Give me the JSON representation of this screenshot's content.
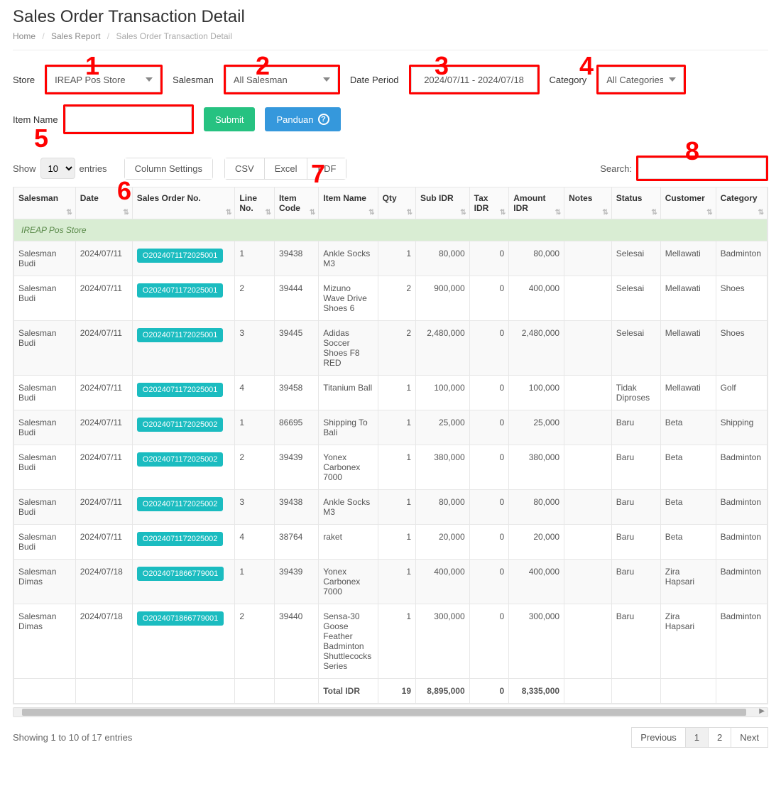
{
  "page_title": "Sales Order Transaction Detail",
  "breadcrumb": {
    "home": "Home",
    "sales_report": "Sales Report",
    "active": "Sales Order Transaction Detail"
  },
  "filters": {
    "store_label": "Store",
    "store_value": "IREAP Pos Store",
    "salesman_label": "Salesman",
    "salesman_value": "All Salesman",
    "date_label": "Date Period",
    "date_value": "2024/07/11 - 2024/07/18",
    "category_label": "Category",
    "category_value": "All Categories",
    "item_name_label": "Item Name",
    "item_name_value": "",
    "submit": "Submit",
    "panduan": "Panduan"
  },
  "table_controls": {
    "show": "Show",
    "entries": "entries",
    "page_size": "10",
    "column_settings": "Column Settings",
    "csv": "CSV",
    "excel": "Excel",
    "pdf": "PDF",
    "search_label": "Search:"
  },
  "columns": [
    "Salesman",
    "Date",
    "Sales Order No.",
    "Line No.",
    "Item Code",
    "Item Name",
    "Qty",
    "Sub IDR",
    "Tax IDR",
    "Amount IDR",
    "Notes",
    "Status",
    "Customer",
    "Category"
  ],
  "group_row": "IREAP Pos Store",
  "rows": [
    {
      "salesman": "Salesman Budi",
      "date": "2024/07/11",
      "order": "O2024071172025001",
      "line": "1",
      "code": "39438",
      "item": "Ankle Socks M3",
      "qty": "1",
      "sub": "80,000",
      "tax": "0",
      "amount": "80,000",
      "notes": "",
      "status": "Selesai",
      "customer": "Mellawati",
      "category": "Badminton"
    },
    {
      "salesman": "Salesman Budi",
      "date": "2024/07/11",
      "order": "O2024071172025001",
      "line": "2",
      "code": "39444",
      "item": "Mizuno Wave Drive Shoes 6",
      "qty": "2",
      "sub": "900,000",
      "tax": "0",
      "amount": "400,000",
      "notes": "",
      "status": "Selesai",
      "customer": "Mellawati",
      "category": "Shoes"
    },
    {
      "salesman": "Salesman Budi",
      "date": "2024/07/11",
      "order": "O2024071172025001",
      "line": "3",
      "code": "39445",
      "item": "Adidas Soccer Shoes F8 RED",
      "qty": "2",
      "sub": "2,480,000",
      "tax": "0",
      "amount": "2,480,000",
      "notes": "",
      "status": "Selesai",
      "customer": "Mellawati",
      "category": "Shoes"
    },
    {
      "salesman": "Salesman Budi",
      "date": "2024/07/11",
      "order": "O2024071172025001",
      "line": "4",
      "code": "39458",
      "item": "Titanium Ball",
      "qty": "1",
      "sub": "100,000",
      "tax": "0",
      "amount": "100,000",
      "notes": "",
      "status": "Tidak Diproses",
      "customer": "Mellawati",
      "category": "Golf"
    },
    {
      "salesman": "Salesman Budi",
      "date": "2024/07/11",
      "order": "O2024071172025002",
      "line": "1",
      "code": "86695",
      "item": "Shipping To Bali",
      "qty": "1",
      "sub": "25,000",
      "tax": "0",
      "amount": "25,000",
      "notes": "",
      "status": "Baru",
      "customer": "Beta",
      "category": "Shipping"
    },
    {
      "salesman": "Salesman Budi",
      "date": "2024/07/11",
      "order": "O2024071172025002",
      "line": "2",
      "code": "39439",
      "item": "Yonex Carbonex 7000",
      "qty": "1",
      "sub": "380,000",
      "tax": "0",
      "amount": "380,000",
      "notes": "",
      "status": "Baru",
      "customer": "Beta",
      "category": "Badminton"
    },
    {
      "salesman": "Salesman Budi",
      "date": "2024/07/11",
      "order": "O2024071172025002",
      "line": "3",
      "code": "39438",
      "item": "Ankle Socks M3",
      "qty": "1",
      "sub": "80,000",
      "tax": "0",
      "amount": "80,000",
      "notes": "",
      "status": "Baru",
      "customer": "Beta",
      "category": "Badminton"
    },
    {
      "salesman": "Salesman Budi",
      "date": "2024/07/11",
      "order": "O2024071172025002",
      "line": "4",
      "code": "38764",
      "item": "raket",
      "qty": "1",
      "sub": "20,000",
      "tax": "0",
      "amount": "20,000",
      "notes": "",
      "status": "Baru",
      "customer": "Beta",
      "category": "Badminton"
    },
    {
      "salesman": "Salesman Dimas",
      "date": "2024/07/18",
      "order": "O2024071866779001",
      "line": "1",
      "code": "39439",
      "item": "Yonex Carbonex 7000",
      "qty": "1",
      "sub": "400,000",
      "tax": "0",
      "amount": "400,000",
      "notes": "",
      "status": "Baru",
      "customer": "Zira Hapsari",
      "category": "Badminton"
    },
    {
      "salesman": "Salesman Dimas",
      "date": "2024/07/18",
      "order": "O2024071866779001",
      "line": "2",
      "code": "39440",
      "item": "Sensa-30 Goose Feather Badminton Shuttlecocks Series",
      "qty": "1",
      "sub": "300,000",
      "tax": "0",
      "amount": "300,000",
      "notes": "",
      "status": "Baru",
      "customer": "Zira Hapsari",
      "category": "Badminton"
    }
  ],
  "totals": {
    "label": "Total IDR",
    "qty": "19",
    "sub": "8,895,000",
    "tax": "0",
    "amount": "8,335,000"
  },
  "footer": {
    "info": "Showing 1 to 10 of 17 entries",
    "prev": "Previous",
    "p1": "1",
    "p2": "2",
    "next": "Next"
  },
  "markers": {
    "m1": "1",
    "m2": "2",
    "m3": "3",
    "m4": "4",
    "m5": "5",
    "m6": "6",
    "m7": "7",
    "m8": "8"
  }
}
